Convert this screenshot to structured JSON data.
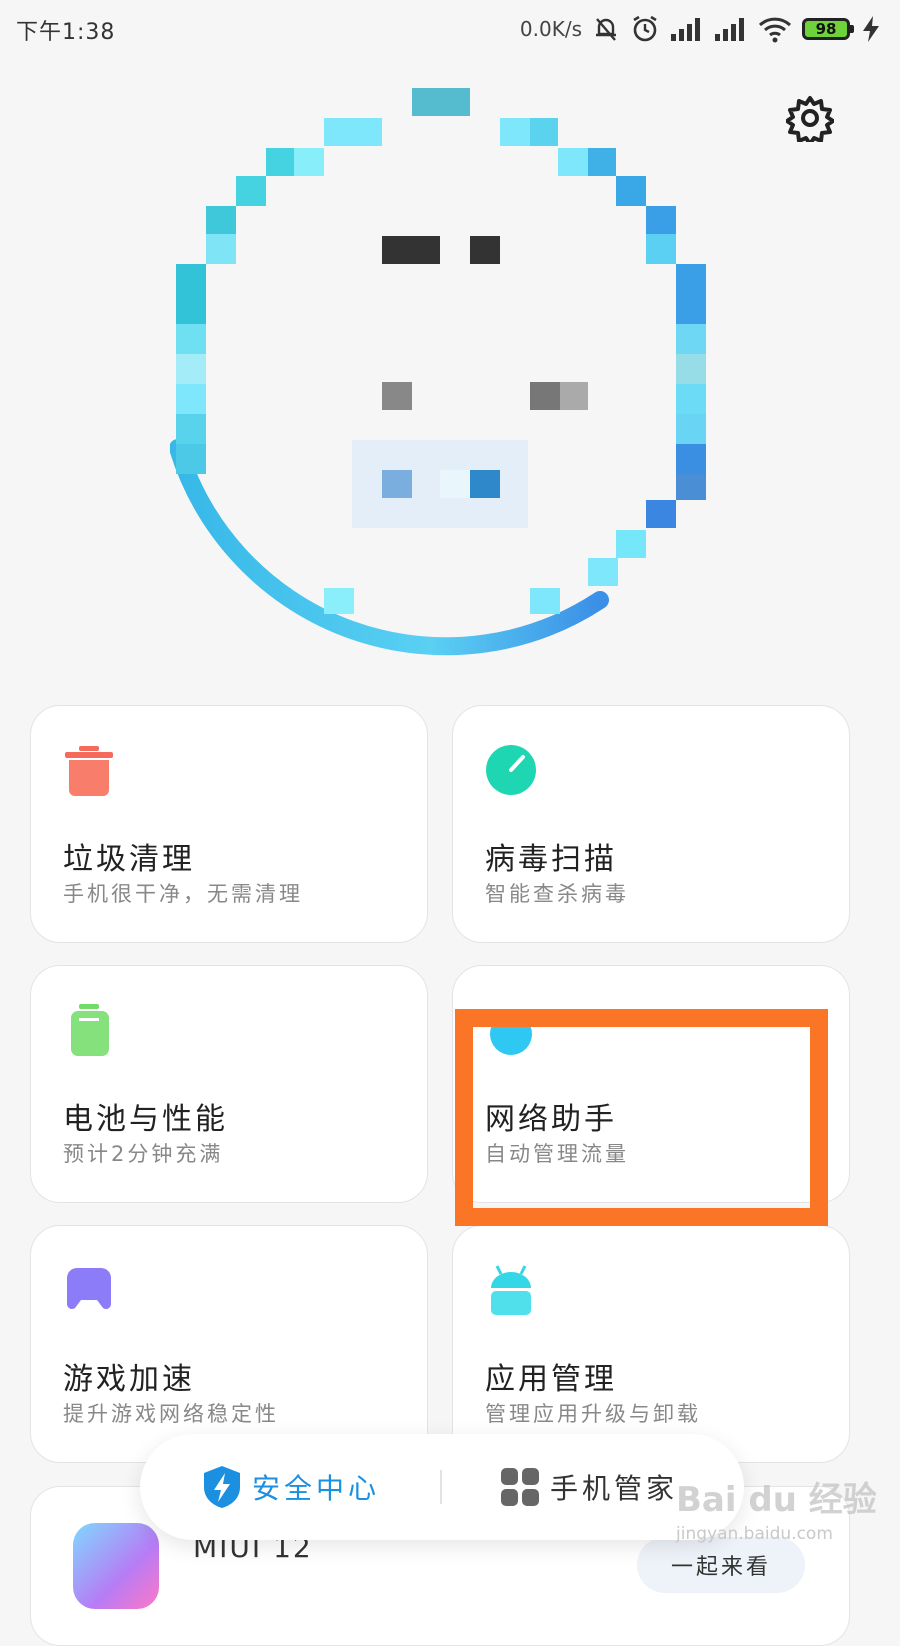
{
  "status_bar": {
    "time": "下午1:38",
    "network_speed": "0.0K/s",
    "battery_level": "98",
    "icons": [
      "mute-bell-icon",
      "alarm-icon",
      "signal-icon",
      "signal-icon",
      "wifi-icon",
      "charging-icon"
    ]
  },
  "header": {
    "settings_icon": "gear-icon"
  },
  "cards": [
    {
      "title": "垃圾清理",
      "subtitle": "手机很干净，无需清理",
      "icon": "trash-icon",
      "color": "#f46b5b"
    },
    {
      "title": "病毒扫描",
      "subtitle": "智能查杀病毒",
      "icon": "scan-icon",
      "color": "#1fd6b2"
    },
    {
      "title": "电池与性能",
      "subtitle": "预计2分钟充满",
      "icon": "battery-icon",
      "color": "#72dc6a"
    },
    {
      "title": "网络助手",
      "subtitle": "自动管理流量",
      "icon": "network-icon",
      "color": "#2ec8f2"
    },
    {
      "title": "游戏加速",
      "subtitle": "提升游戏网络稳定性",
      "icon": "gamepad-icon",
      "color": "#8c7cf8"
    },
    {
      "title": "应用管理",
      "subtitle": "管理应用升级与卸载",
      "icon": "android-icon",
      "color": "#35d6e6"
    }
  ],
  "bottom_card": {
    "title": "MIUI 12",
    "button": "一起来看"
  },
  "tabbar": {
    "tabs": [
      {
        "label": "安全中心",
        "icon": "shield-bolt-icon",
        "active": true
      },
      {
        "label": "手机管家",
        "icon": "grid-icon",
        "active": false
      }
    ]
  },
  "watermark": {
    "main": "Bai du 经验",
    "sub": "jingyan.baidu.com"
  },
  "colors": {
    "accent": "#1b8fe0",
    "highlight": "#fb7526",
    "background": "#f6f6f6"
  }
}
